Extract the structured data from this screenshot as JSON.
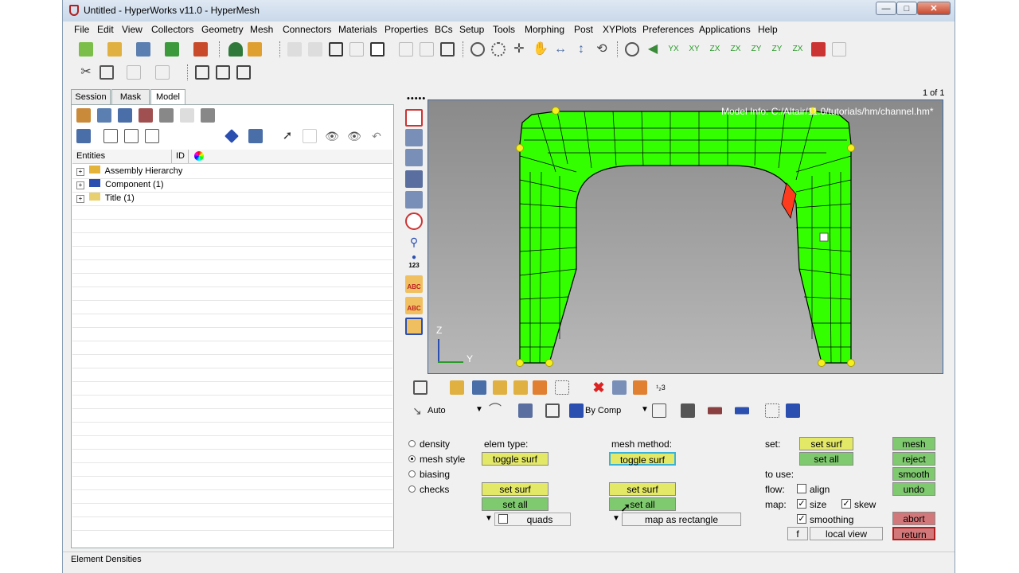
{
  "window": {
    "title": "Untitled - HyperWorks v11.0 - HyperMesh",
    "minimize": "—",
    "maximize": "□",
    "close": "✕"
  },
  "menu": [
    "File",
    "Edit",
    "View",
    "Collectors",
    "Geometry",
    "Mesh",
    "Connectors",
    "Materials",
    "Properties",
    "BCs",
    "Setup",
    "Tools",
    "Morphing",
    "Post",
    "XYPlots",
    "Preferences",
    "Applications",
    "Help"
  ],
  "tabs": [
    "Session",
    "Mask",
    "Model"
  ],
  "tree": {
    "col_entities": "Entities",
    "col_id": "ID",
    "items": [
      "Assembly Hierarchy",
      "Component (1)",
      "Title (1)"
    ]
  },
  "viewport": {
    "page_indicator": "1 of 1",
    "model_info": "Model Info: C:/Altair/11.0/tutorials/hm/channel.hm*",
    "axis_z": "Z",
    "axis_y": "Y"
  },
  "viewbar": {
    "auto_label": "Auto",
    "by_comp_label": "By Comp"
  },
  "panel": {
    "radios": [
      "density",
      "mesh style",
      "biasing",
      "checks"
    ],
    "selected_radio": "mesh style",
    "elem_type_label": "elem type:",
    "mesh_method_label": "mesh method:",
    "toggle_surf": "toggle surf",
    "set_surf": "set surf",
    "set_all": "set all",
    "quads": "quads",
    "map_as_rectangle": "map as rectangle",
    "set_label": "set:",
    "to_use_label": "to use:",
    "flow_label": "flow:",
    "align": "align",
    "map_label": "map:",
    "size": "size",
    "skew": "skew",
    "smoothing": "smoothing",
    "f_button": "f",
    "local_view": "local view",
    "mesh": "mesh",
    "reject": "reject",
    "smooth": "smooth",
    "undo": "undo",
    "abort": "abort",
    "return": "return"
  },
  "status": "Element Densities",
  "colors": {
    "mesh_fill": "#33ff00",
    "highlight_elem": "#ff3b1e",
    "accent_yellow": "#e3e867",
    "accent_green": "#7fc96f",
    "accent_red": "#d2787a"
  }
}
